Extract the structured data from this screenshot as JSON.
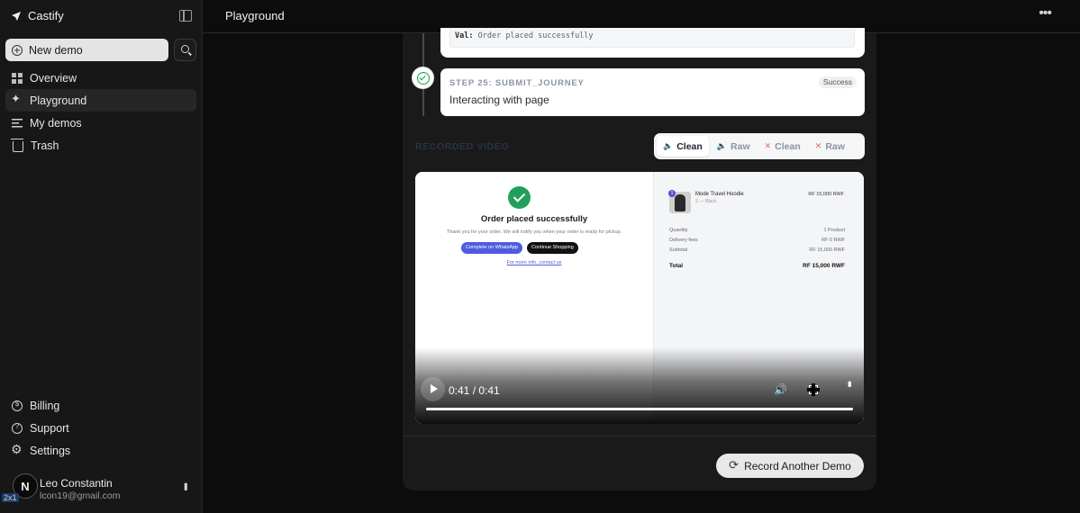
{
  "app": {
    "name": "Castify"
  },
  "sidebar": {
    "new_demo_label": "New demo",
    "nav_top": [
      {
        "label": "Overview",
        "icon": "grid-icon",
        "active": false
      },
      {
        "label": "Playground",
        "icon": "sparkle-icon",
        "active": true
      },
      {
        "label": "My demos",
        "icon": "list-icon",
        "active": false
      },
      {
        "label": "Trash",
        "icon": "trash-icon",
        "active": false
      }
    ],
    "nav_bottom": [
      {
        "label": "Billing",
        "icon": "billing-icon"
      },
      {
        "label": "Support",
        "icon": "help-icon"
      },
      {
        "label": "Settings",
        "icon": "gear-icon"
      }
    ],
    "user": {
      "initial": "N",
      "name": "Leo Constantin",
      "email": "lcon19@gmail.com",
      "badge": "2x1"
    }
  },
  "header": {
    "title": "Playground"
  },
  "steps": {
    "prev_code_key": "Val:",
    "prev_code_value": "Order placed successfully",
    "current": {
      "label": "STEP 25: SUBMIT_JOURNEY",
      "description": "Interacting with page",
      "status": "Success"
    }
  },
  "recorded": {
    "label": "RECORDED VIDEO",
    "modes": [
      {
        "label": "Clean",
        "audio": true,
        "active": true
      },
      {
        "label": "Raw",
        "audio": true,
        "active": false
      },
      {
        "label": "Clean",
        "audio": false,
        "active": false
      },
      {
        "label": "Raw",
        "audio": false,
        "active": false
      }
    ]
  },
  "video": {
    "frame": {
      "title": "Order placed successfully",
      "subtitle": "Thank you for your order. We will notify you when your order is ready for pickup.",
      "btn_whatsapp": "Complete on WhatsApp",
      "btn_continue": "Continue Shopping",
      "link": "For more info, contact us",
      "product": {
        "qty_badge": "1",
        "name": "Mode Travel Hoodie",
        "variant": "S — Black",
        "price": "RF 15,000 RWF"
      },
      "summary": [
        {
          "label": "Quantity",
          "value": "1 Product"
        },
        {
          "label": "Delivery fees",
          "value": "RF 0 RWF"
        },
        {
          "label": "Subtotal",
          "value": "RF 15,000 RWF"
        }
      ],
      "total": {
        "label": "Total",
        "value": "RF 15,000 RWF"
      }
    },
    "time": "0:41 / 0:41",
    "progress": 1.0
  },
  "actions": {
    "record_another": "Record Another Demo"
  }
}
